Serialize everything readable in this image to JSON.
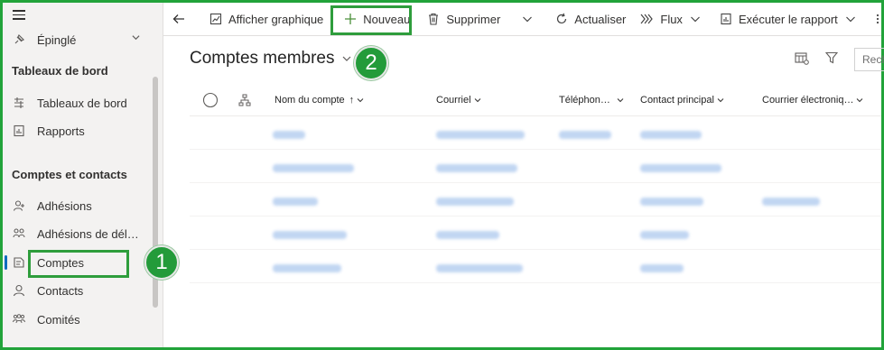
{
  "sidebar": {
    "pinned_label": "Épinglé",
    "section_dashboards": "Tableaux de bord",
    "items_dashboards": [
      {
        "label": "Tableaux de bord",
        "icon": "dashboard-icon"
      },
      {
        "label": "Rapports",
        "icon": "reports-icon"
      }
    ],
    "section_accounts": "Comptes et contacts",
    "items_accounts": [
      {
        "label": "Adhésions",
        "icon": "membership-icon"
      },
      {
        "label": "Adhésions de dél…",
        "icon": "delegate-membership-icon"
      },
      {
        "label": "Comptes",
        "icon": "accounts-icon"
      },
      {
        "label": "Contacts",
        "icon": "contact-icon"
      },
      {
        "label": "Comités",
        "icon": "committees-icon"
      }
    ]
  },
  "annotations": {
    "badge_1": "1",
    "badge_2": "2",
    "highlight_color": "#2e9d3c"
  },
  "toolbar": {
    "show_chart": "Afficher graphique",
    "new": "Nouveau",
    "delete": "Supprimer",
    "refresh": "Actualiser",
    "flow": "Flux",
    "run_report": "Exécuter le rapport"
  },
  "view": {
    "title": "Comptes membres",
    "search_placeholder": "Rech"
  },
  "grid": {
    "columns": [
      "Nom du compte",
      "Courriel",
      "Téléphon…",
      "Contact principal",
      "Courrier électroniq…"
    ],
    "sort_indicator": "↑",
    "blurred_rows": 5
  },
  "colors": {
    "accent": "#0f6cbd",
    "frame": "#22a33a",
    "badge": "#239b3a"
  }
}
